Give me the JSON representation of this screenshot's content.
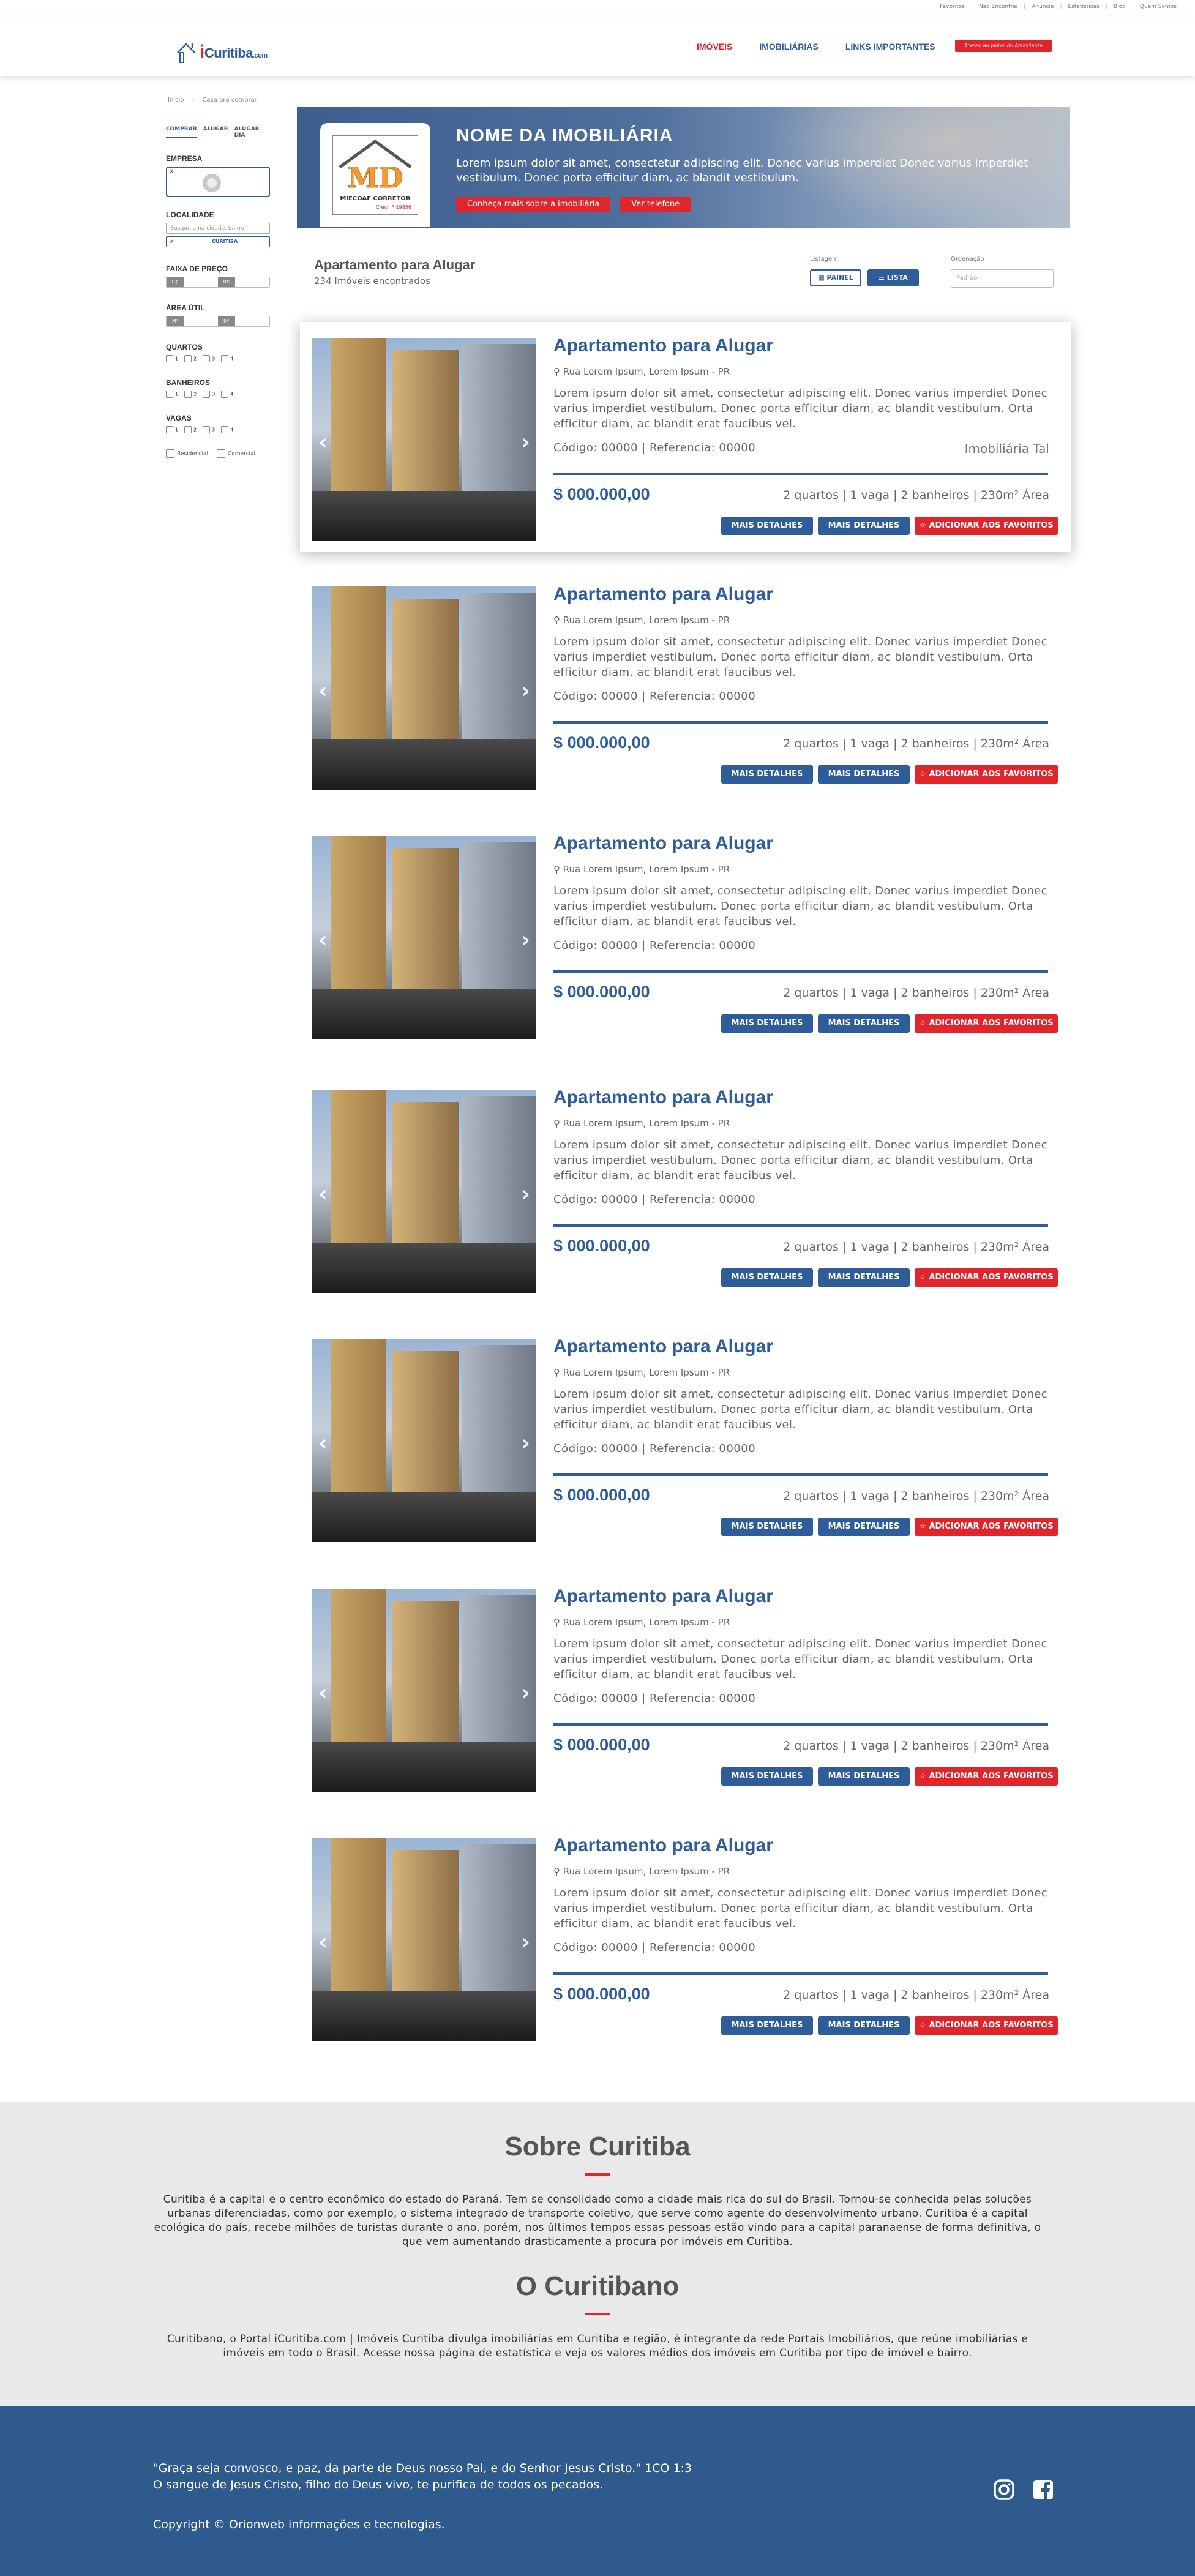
{
  "topbar": {
    "links": [
      "Favoritos",
      "Não Encontrei",
      "Anuncie",
      "Estatísticas",
      "Blog",
      "Quem Somos"
    ]
  },
  "header": {
    "logo_i": "i",
    "logo_text": "Curitiba",
    "logo_com": ".com",
    "nav": [
      "IMÓVEIS",
      "IMOBILIÁRIAS",
      "LINKS IMPORTANTES"
    ],
    "panel_button": "Acesso ao painel do Anunciante"
  },
  "breadcrumb": [
    "Início",
    "Casa pra comprar"
  ],
  "sidebar": {
    "tabs": [
      "COMPRAR",
      "ALUGAR",
      "ALUGAR DIA"
    ],
    "empresa_label": "EMPRESA",
    "empresa_placeholder": "X",
    "localidade_label": "LOCALIDADE",
    "localidade_placeholder": "Busque uma cidade, bairro...",
    "loc_state": "X",
    "loc_city": "CURITIBA",
    "preco_label": "FAIXA DE PREÇO",
    "preco_min_tag": "R$",
    "preco_max_tag": "R$",
    "area_label": "ÁREA ÚTIL",
    "area_min_tag": "M²",
    "area_max_tag": "M²",
    "quartos_label": "QUARTOS",
    "banheiros_label": "BANHEIROS",
    "vagas_label": "VAGAS",
    "count_options": [
      "1",
      "2",
      "3",
      "4"
    ],
    "types": [
      "Residencial",
      "Comercial"
    ]
  },
  "banner": {
    "logo_letters": "MD",
    "logo_caption": "MIECOAF CORRETOR",
    "logo_creci": "Creci: F 19856",
    "title": "NOME DA IMOBILIÁRIA",
    "description": "Lorem ipsum dolor sit amet, consectetur adipiscing elit. Donec varius imperdiet Donec varius imperdiet vestibulum. Donec porta efficitur diam, ac blandit vestibulum.",
    "btn_about": "Conheça mais sobre a imobiliária",
    "btn_phone": "Ver telefone"
  },
  "results": {
    "title": "Apartamento para Alugar",
    "count": "234  Imóveis encontrados",
    "listagem_label": "Listagem",
    "view_panel": "PAINEL",
    "view_list": "LISTA",
    "ordenacao_label": "Ordenação",
    "ordenacao_value": "Padrão"
  },
  "listings": [
    {
      "title": "Apartamento para Alugar",
      "address": "Rua Lorem Ipsum, Lorem Ipsum - PR",
      "description": "Lorem ipsum dolor sit amet, consectetur adipiscing elit. Donec varius imperdiet Donec varius imperdiet vestibulum. Donec porta efficitur diam, ac blandit vestibulum. Orta efficitur diam, ac blandit erat faucibus vel.",
      "code": "Código: 00000   |   Referencia: 00000",
      "agency": "Imobiliária Tal",
      "price": "$ 000.000,00",
      "features": "2 quartos   |   1 vaga   |   2 banheiros   |  230m² Área",
      "btn_details_1": "MAIS DETALHES",
      "btn_details_2": "MAIS DETALHES",
      "btn_fav": "ADICIONAR AOS FAVORITOS"
    },
    {
      "title": "Apartamento para Alugar",
      "address": "Rua Lorem Ipsum, Lorem Ipsum - PR",
      "description": "Lorem ipsum dolor sit amet, consectetur adipiscing elit. Donec varius imperdiet Donec varius imperdiet vestibulum. Donec porta efficitur diam, ac blandit vestibulum. Orta efficitur diam, ac blandit erat faucibus vel.",
      "code": "Código: 00000   |   Referencia: 00000",
      "agency": "",
      "price": "$ 000.000,00",
      "features": "2 quartos   |   1 vaga   |   2 banheiros   |  230m² Área",
      "btn_details_1": "MAIS DETALHES",
      "btn_details_2": "MAIS DETALHES",
      "btn_fav": "ADICIONAR AOS FAVORITOS"
    },
    {
      "title": "Apartamento para Alugar",
      "address": "Rua Lorem Ipsum, Lorem Ipsum - PR",
      "description": "Lorem ipsum dolor sit amet, consectetur adipiscing elit. Donec varius imperdiet Donec varius imperdiet vestibulum. Donec porta efficitur diam, ac blandit vestibulum. Orta efficitur diam, ac blandit erat faucibus vel.",
      "code": "Código: 00000   |   Referencia: 00000",
      "agency": "",
      "price": "$ 000.000,00",
      "features": "2 quartos   |   1 vaga   |   2 banheiros   |  230m² Área",
      "btn_details_1": "MAIS DETALHES",
      "btn_details_2": "MAIS DETALHES",
      "btn_fav": "ADICIONAR AOS FAVORITOS"
    },
    {
      "title": "Apartamento para Alugar",
      "address": "Rua Lorem Ipsum, Lorem Ipsum - PR",
      "description": "Lorem ipsum dolor sit amet, consectetur adipiscing elit. Donec varius imperdiet Donec varius imperdiet vestibulum. Donec porta efficitur diam, ac blandit vestibulum. Orta efficitur diam, ac blandit erat faucibus vel.",
      "code": "Código: 00000   |   Referencia: 00000",
      "agency": "",
      "price": "$ 000.000,00",
      "features": "2 quartos   |   1 vaga   |   2 banheiros   |  230m² Área",
      "btn_details_1": "MAIS DETALHES",
      "btn_details_2": "MAIS DETALHES",
      "btn_fav": "ADICIONAR AOS FAVORITOS"
    },
    {
      "title": "Apartamento para Alugar",
      "address": "Rua Lorem Ipsum, Lorem Ipsum - PR",
      "description": "Lorem ipsum dolor sit amet, consectetur adipiscing elit. Donec varius imperdiet Donec varius imperdiet vestibulum. Donec porta efficitur diam, ac blandit vestibulum. Orta efficitur diam, ac blandit erat faucibus vel.",
      "code": "Código: 00000   |   Referencia: 00000",
      "agency": "",
      "price": "$ 000.000,00",
      "features": "2 quartos   |   1 vaga   |   2 banheiros   |  230m² Área",
      "btn_details_1": "MAIS DETALHES",
      "btn_details_2": "MAIS DETALHES",
      "btn_fav": "ADICIONAR AOS FAVORITOS"
    },
    {
      "title": "Apartamento para Alugar",
      "address": "Rua Lorem Ipsum, Lorem Ipsum - PR",
      "description": "Lorem ipsum dolor sit amet, consectetur adipiscing elit. Donec varius imperdiet Donec varius imperdiet vestibulum. Donec porta efficitur diam, ac blandit vestibulum. Orta efficitur diam, ac blandit erat faucibus vel.",
      "code": "Código: 00000   |   Referencia: 00000",
      "agency": "",
      "price": "$ 000.000,00",
      "features": "2 quartos   |   1 vaga   |   2 banheiros   |  230m² Área",
      "btn_details_1": "MAIS DETALHES",
      "btn_details_2": "MAIS DETALHES",
      "btn_fav": "ADICIONAR AOS FAVORITOS"
    },
    {
      "title": "Apartamento para Alugar",
      "address": "Rua Lorem Ipsum, Lorem Ipsum - PR",
      "description": "Lorem ipsum dolor sit amet, consectetur adipiscing elit. Donec varius imperdiet Donec varius imperdiet vestibulum. Donec porta efficitur diam, ac blandit vestibulum. Orta efficitur diam, ac blandit erat faucibus vel.",
      "code": "Código: 00000   |   Referencia: 00000",
      "agency": "",
      "price": "$ 000.000,00",
      "features": "2 quartos   |   1 vaga   |   2 banheiros   |  230m² Área",
      "btn_details_1": "MAIS DETALHES",
      "btn_details_2": "MAIS DETALHES",
      "btn_fav": "ADICIONAR AOS FAVORITOS"
    }
  ],
  "about": {
    "title1": "Sobre Curitiba",
    "text1": "Curitiba é a capital e o centro econômico do estado do Paraná. Tem se consolidado como a cidade mais rica do sul do Brasil. Tornou-se conhecida pelas soluções urbanas diferenciadas, como por exemplo, o sistema integrado de transporte coletivo, que serve como agente do desenvolvimento urbano. Curitiba é a capital ecológica do país, recebe milhões de turistas durante o ano, porém, nos últimos tempos essas pessoas estão vindo para a capital paranaense de forma definitiva, o que vem aumentando drasticamente a procura por imóveis em Curitiba.",
    "title2": "O Curitibano",
    "text2": "Curitibano, o Portal iCuritiba.com | Imóveis Curitiba divulga imobiliárias em Curitiba e região, é integrante da rede Portais Imobiliários, que reúne imobiliárias e imóveis em todo o Brasil. Acesse nossa página de estatística e veja os valores médios dos imóveis em Curitiba por tipo de imóvel e bairro."
  },
  "footer": {
    "quote1": "\"Graça seja convosco, e paz, da parte de Deus nosso Pai, e do Senhor Jesus Cristo.\" 1CO 1:3",
    "quote2": "O sangue de Jesus Cristo, filho do Deus vivo, te purifica de todos os pecados.",
    "copyright": "Copyright © Orionweb informações e tecnologias."
  },
  "colors": {
    "brand_blue": "#2f5d9a",
    "accent_red": "#e1252c",
    "footer_blue": "#2f5a8e"
  }
}
